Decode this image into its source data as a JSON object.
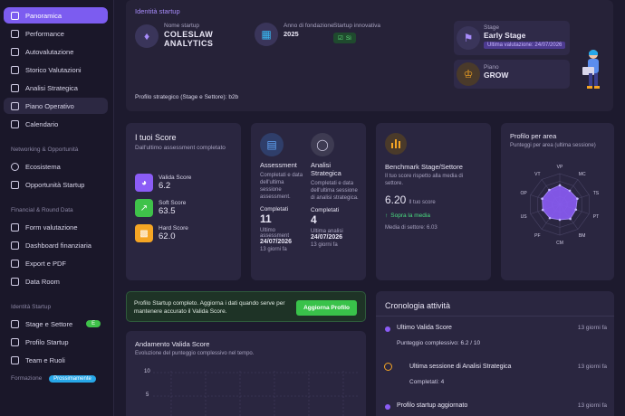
{
  "sidebar": {
    "main": [
      {
        "label": "Panoramica",
        "icon": "home-icon"
      },
      {
        "label": "Performance",
        "icon": "chart-icon"
      },
      {
        "label": "Autovalutazione",
        "icon": "checklist-icon"
      },
      {
        "label": "Storico Valutazioni",
        "icon": "history-icon"
      },
      {
        "label": "Analisi Strategica",
        "icon": "bulb-icon"
      },
      {
        "label": "Piano Operativo",
        "icon": "list-icon"
      },
      {
        "label": "Calendario",
        "icon": "calendar-icon"
      }
    ],
    "networking_title": "Networking & Opportunità",
    "networking": [
      {
        "label": "Ecosistema",
        "icon": "globe-icon"
      },
      {
        "label": "Opportunità Startup",
        "icon": "rocket-icon"
      }
    ],
    "financial_title": "Financial & Round Data",
    "financial": [
      {
        "label": "Form valutazione",
        "icon": "form-icon"
      },
      {
        "label": "Dashboard finanziaria",
        "icon": "dashboard-icon"
      },
      {
        "label": "Export e PDF",
        "icon": "export-icon"
      },
      {
        "label": "Data Room",
        "icon": "folder-icon"
      }
    ],
    "identity_title": "Identità Startup",
    "identity": [
      {
        "label": "Stage e Settore",
        "icon": "trend-icon",
        "badge": "E"
      },
      {
        "label": "Profilo Startup",
        "icon": "bulb-icon"
      },
      {
        "label": "Team e Ruoli",
        "icon": "team-icon"
      }
    ],
    "formation_title": "Formazione",
    "formation_badge": "Prossimamente"
  },
  "identity": {
    "section_title": "Identità startup",
    "name_label": "Nome startup",
    "name_value": "COLESLAW ANALYTICS",
    "founded_label": "Anno di fondazione",
    "founded_value": "2025",
    "innovative_label": "Startup innovativa",
    "innovative_value": "Sì",
    "stage_label": "Stage",
    "stage_value": "Early Stage",
    "stage_note": "Ultima valutazione: 24/07/2026",
    "plan_label": "Piano",
    "plan_value": "GROW",
    "profile_line": "Profilo strategico (Stage e Settore): b2b"
  },
  "scores": {
    "title": "I tuoi Score",
    "subtitle": "Dall'ultimo assessment completato",
    "items": [
      {
        "label": "Valida Score",
        "value": "6.2",
        "color": "#8b5cf6"
      },
      {
        "label": "Soft Score",
        "value": "63.5",
        "color": "#3fc24a"
      },
      {
        "label": "Hard Score",
        "value": "62.0",
        "color": "#f5a524"
      }
    ]
  },
  "assessment": {
    "title": "Assessment",
    "desc": "Completati e data dell'ultima sessione assessment.",
    "count_label": "Completati",
    "count": "11",
    "last_label": "Ultimo assessment",
    "last_date": "24/07/2026",
    "ago": "13 giorni fa"
  },
  "strategic": {
    "title": "Analisi Strategica",
    "desc": "Completati e data dell'ultima sessione di analisi strategica.",
    "count_label": "Completati",
    "count": "4",
    "last_label": "Ultima analisi",
    "last_date": "24/07/2026",
    "ago": "13 giorni fa"
  },
  "benchmark": {
    "title": "Benchmark Stage/Settore",
    "desc": "Il tuo score rispetto alla media di settore.",
    "score": "6.20",
    "score_label": "Il tuo score",
    "status": "Sopra la media",
    "avg": "Media di settore: 6.03"
  },
  "radar": {
    "title": "Profilo per area",
    "subtitle": "Punteggi per area (ultima sessione)",
    "axes": [
      "VP",
      "MC",
      "TS",
      "PT",
      "BM",
      "CM",
      "PF",
      "US",
      "OP",
      "VT"
    ],
    "values": [
      0.62,
      0.55,
      0.6,
      0.55,
      0.58,
      0.5,
      0.55,
      0.58,
      0.6,
      0.58
    ]
  },
  "banner": {
    "text": "Profilo Startup completo. Aggiorna i dati quando serve per mantenere accurato il Valida Score.",
    "button": "Aggiorna Profilo"
  },
  "trend": {
    "title": "Andamento Valida Score",
    "subtitle": "Evoluzione del punteggio complessivo nel tempo.",
    "ticks": [
      "10",
      "5"
    ]
  },
  "timeline": {
    "title": "Cronologia attività",
    "items": [
      {
        "title": "Ultimo Valida Score",
        "detail": "Punteggio complessivo: 6.2 / 10",
        "ago": "13 giorni fa",
        "icon": "dot-icon"
      },
      {
        "title": "Ultima sessione di Analisi Strategica",
        "detail": "Completati: 4",
        "ago": "13 giorni fa",
        "icon": "bulb-icon"
      },
      {
        "title": "Profilo startup aggiornato",
        "detail": "",
        "ago": "13 giorni fa",
        "icon": "dot-icon"
      }
    ]
  }
}
